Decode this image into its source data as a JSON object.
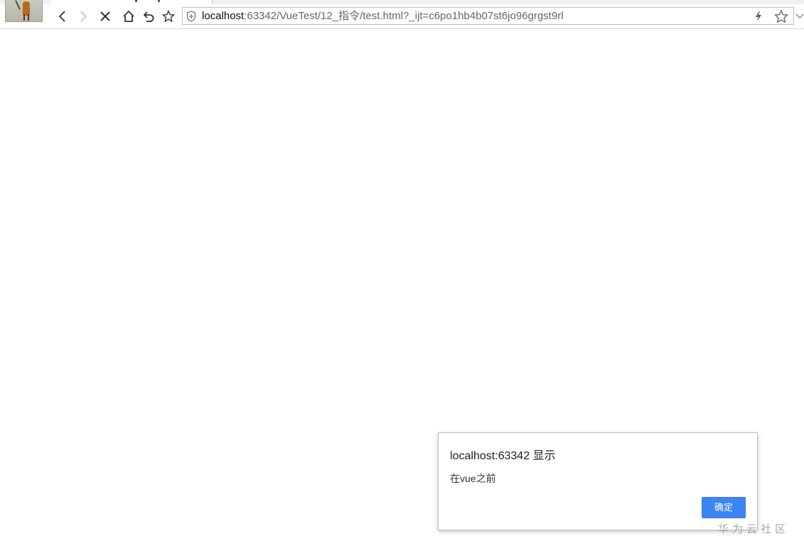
{
  "browser": {
    "address_bar": {
      "host": "localhost",
      "path": ":63342/VueTest/12_指令/test.html?_ijt=c6po1hb4b07st6jo96grgst9rl"
    },
    "toolbar_icons": [
      "back-icon",
      "forward-icon",
      "stop-icon",
      "home-icon",
      "undo-icon",
      "star-icon",
      "shield-icon",
      "lightning-icon",
      "favorite-star-icon",
      "chevron-down-icon"
    ]
  },
  "alert_dialog": {
    "title": "localhost:63342 显示",
    "message": "在vue之前",
    "ok_label": "确定",
    "accent_color": "#3b86f3"
  },
  "watermark": {
    "text": "华为云社区"
  }
}
